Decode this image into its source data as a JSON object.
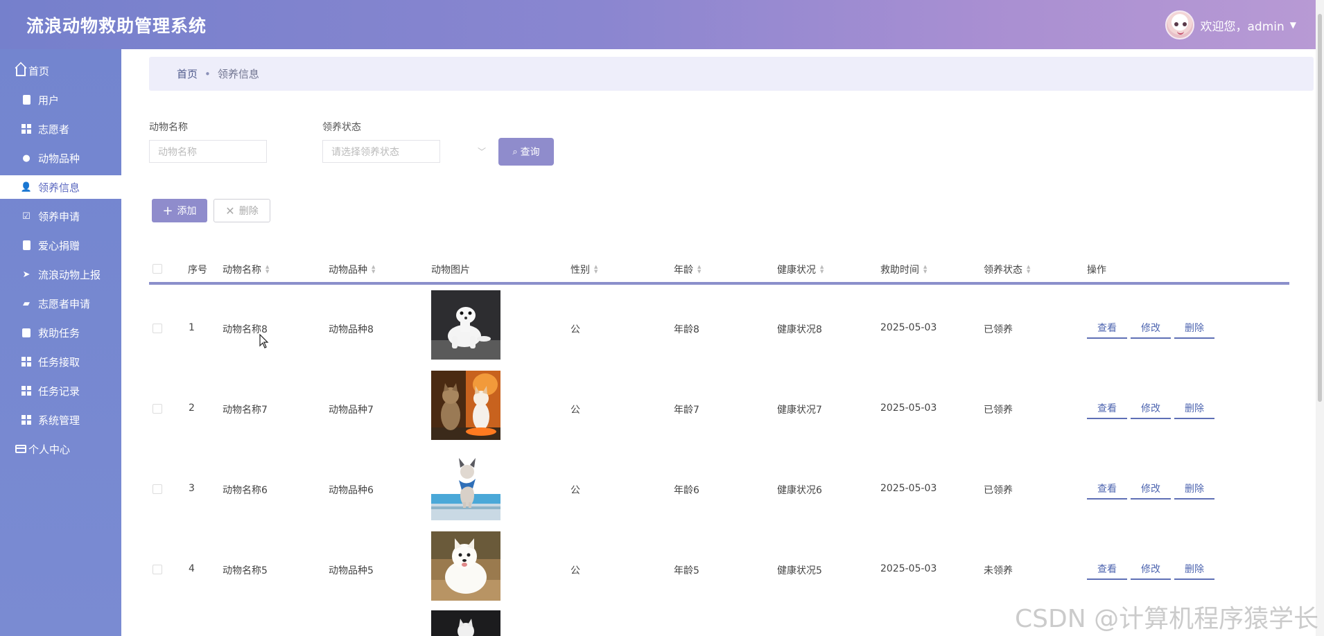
{
  "header": {
    "app_title": "流浪动物救助管理系统",
    "welcome": "欢迎您，admin"
  },
  "sidebar": {
    "items": [
      {
        "label": "首页",
        "icon": "home-icon"
      },
      {
        "label": "用户",
        "icon": "clipboard-icon"
      },
      {
        "label": "志愿者",
        "icon": "grid-icon"
      },
      {
        "label": "动物品种",
        "icon": "bulb-icon"
      },
      {
        "label": "领养信息",
        "icon": "user-icon",
        "active": true
      },
      {
        "label": "领养申请",
        "icon": "checkbox-icon"
      },
      {
        "label": "爱心捐赠",
        "icon": "clipboard-check-icon"
      },
      {
        "label": "流浪动物上报",
        "icon": "send-icon"
      },
      {
        "label": "志愿者申请",
        "icon": "comment-icon"
      },
      {
        "label": "救助任务",
        "icon": "book-icon"
      },
      {
        "label": "任务接取",
        "icon": "grid-icon"
      },
      {
        "label": "任务记录",
        "icon": "grid-icon"
      },
      {
        "label": "系统管理",
        "icon": "grid-icon"
      },
      {
        "label": "个人中心",
        "icon": "card-icon"
      }
    ]
  },
  "breadcrumb": {
    "home": "首页",
    "separator": "•",
    "current": "领养信息"
  },
  "search": {
    "name_label": "动物名称",
    "name_placeholder": "动物名称",
    "status_label": "领养状态",
    "status_placeholder": "请选择领养状态",
    "query_button": "查询"
  },
  "actions": {
    "add": "添加",
    "delete": "删除"
  },
  "table": {
    "columns": [
      "序号",
      "动物名称",
      "动物品种",
      "动物图片",
      "性别",
      "年龄",
      "健康状况",
      "救助时间",
      "领养状态",
      "操作"
    ],
    "rows": [
      {
        "index": "1",
        "name": "动物名称8",
        "breed": "动物品种8",
        "image": "white-ermine",
        "gender": "公",
        "age": "年龄8",
        "health": "健康状况8",
        "date": "2025-05-03",
        "status": "已领养"
      },
      {
        "index": "2",
        "name": "动物名称7",
        "breed": "动物品种7",
        "image": "two-cats",
        "gender": "公",
        "age": "年龄7",
        "health": "健康状况7",
        "date": "2025-05-03",
        "status": "已领养"
      },
      {
        "index": "3",
        "name": "动物名称6",
        "breed": "动物品种6",
        "image": "dog-scarf-beach",
        "gender": "公",
        "age": "年龄6",
        "health": "健康状况6",
        "date": "2025-05-03",
        "status": "已领养"
      },
      {
        "index": "4",
        "name": "动物名称5",
        "breed": "动物品种5",
        "image": "samoyed",
        "gender": "公",
        "age": "年龄5",
        "health": "健康状况5",
        "date": "2025-05-03",
        "status": "未领养"
      },
      {
        "image": "partial-dog"
      }
    ],
    "op_view": "查看",
    "op_edit": "修改",
    "op_delete": "删除"
  },
  "watermark": "CSDN @计算机程序猿学长",
  "colors": {
    "header_start": "#7580cc",
    "header_end": "#b89ad4",
    "sidebar": "#7385cf",
    "accent": "#8f8ccc",
    "table_rule": "#8b8fcb"
  }
}
